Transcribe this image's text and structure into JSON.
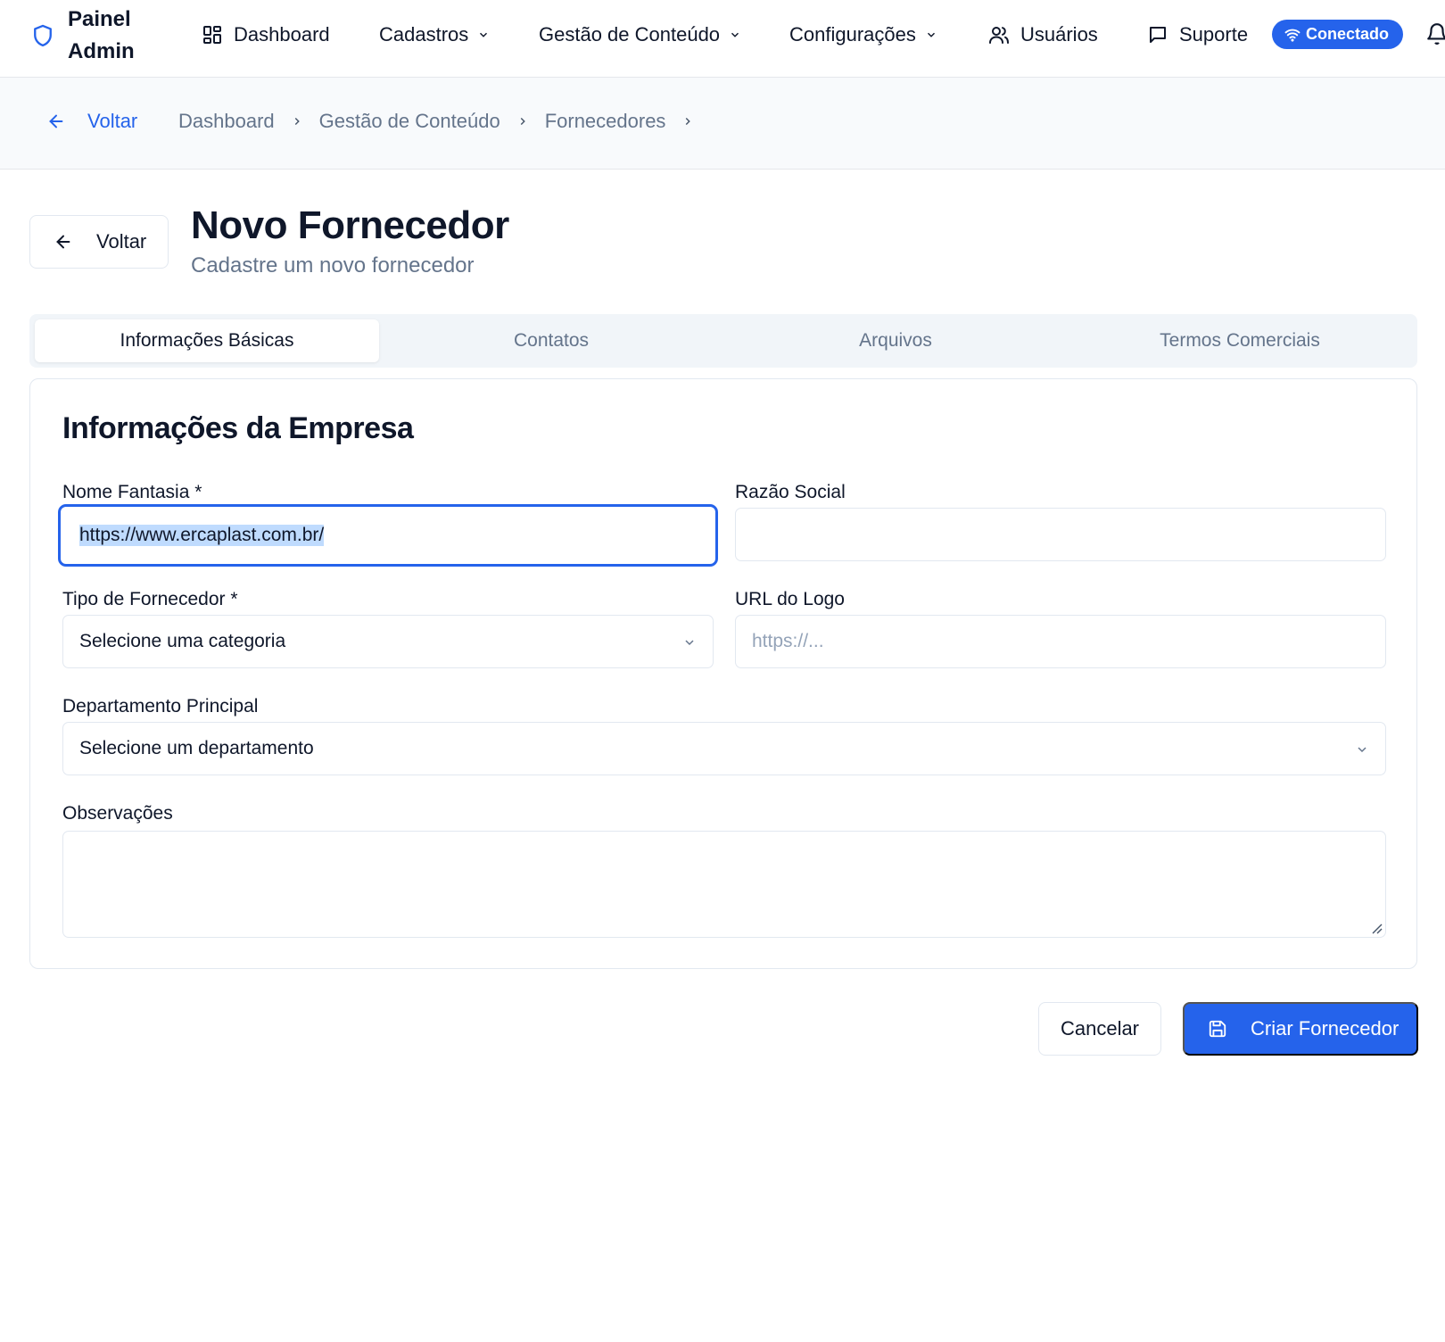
{
  "brand": {
    "name_line1": "Painel",
    "name_line2": "Admin"
  },
  "nav": {
    "dashboard": "Dashboard",
    "cadastros": "Cadastros",
    "gestao": "Gestão de Conteúdo",
    "config": "Configurações",
    "usuarios": "Usuários",
    "suporte": "Suporte",
    "status": "Conectado"
  },
  "breadcrumb": {
    "back": "Voltar",
    "items": [
      "Dashboard",
      "Gestão de Conteúdo",
      "Fornecedores"
    ]
  },
  "header": {
    "back_button": "Voltar",
    "title": "Novo Fornecedor",
    "subtitle": "Cadastre um novo fornecedor"
  },
  "tabs": [
    {
      "label": "Informações Básicas",
      "active": true
    },
    {
      "label": "Contatos",
      "active": false
    },
    {
      "label": "Arquivos",
      "active": false
    },
    {
      "label": "Termos Comerciais",
      "active": false
    }
  ],
  "form": {
    "section_title": "Informações da Empresa",
    "nome_fantasia": {
      "label": "Nome Fantasia *",
      "value": "https://www.ercaplast.com.br/"
    },
    "razao_social": {
      "label": "Razão Social",
      "value": ""
    },
    "tipo": {
      "label": "Tipo de Fornecedor *",
      "value": "Selecione uma categoria"
    },
    "url_logo": {
      "label": "URL do Logo",
      "placeholder": "https://..."
    },
    "departamento": {
      "label": "Departamento Principal",
      "value": "Selecione um departamento"
    },
    "observacoes": {
      "label": "Observações",
      "value": ""
    }
  },
  "actions": {
    "cancel": "Cancelar",
    "create": "Criar Fornecedor"
  },
  "colors": {
    "accent": "#2563eb",
    "muted": "#64748b",
    "border": "#e2e8f0"
  },
  "icons": [
    "shield-icon",
    "grid-icon",
    "chevron-down-icon",
    "users-icon",
    "message-icon",
    "wifi-icon",
    "bell-icon",
    "arrow-left-icon",
    "chevron-right-icon",
    "save-icon"
  ]
}
